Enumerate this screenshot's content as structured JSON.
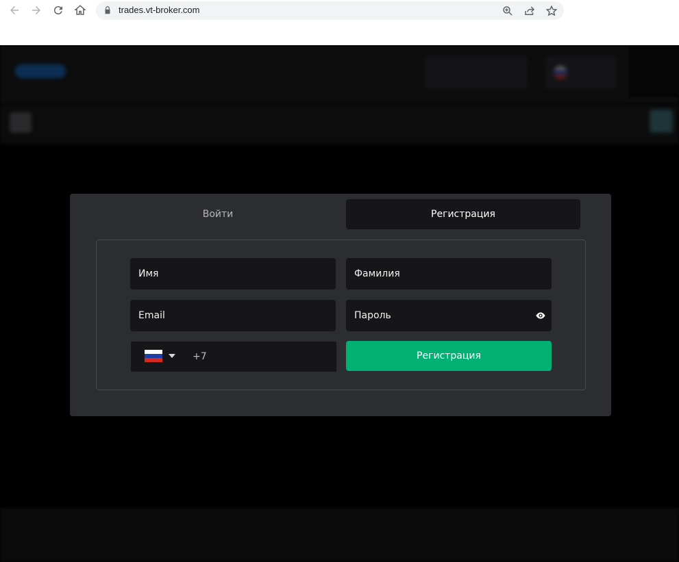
{
  "browser": {
    "url": "trades.vt-broker.com",
    "icons": [
      "back-icon",
      "forward-icon",
      "reload-icon",
      "home-icon",
      "lock-icon",
      "zoom-icon",
      "share-icon",
      "star-icon"
    ]
  },
  "modal": {
    "tabs": {
      "login": "Войти",
      "register": "Регистрация"
    },
    "fields": {
      "first_name": "Имя",
      "last_name": "Фамилия",
      "email": "Email",
      "password": "Пароль"
    },
    "phone": {
      "country": "RU",
      "prefix": "+7"
    },
    "submit_label": "Регистрация"
  },
  "colors": {
    "accent": "#00b173",
    "modal_bg": "#2c2d31",
    "field_bg": "#161618"
  }
}
